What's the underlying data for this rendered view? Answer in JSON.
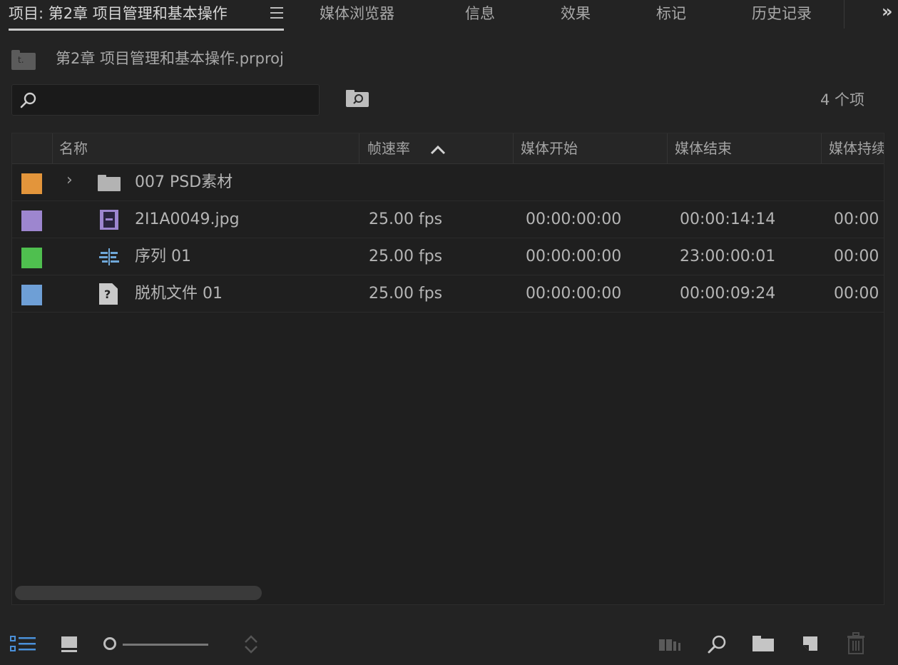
{
  "tabs": [
    {
      "label": "项目: 第2章 项目管理和基本操作",
      "active": true
    },
    {
      "label": "媒体浏览器"
    },
    {
      "label": "信息"
    },
    {
      "label": "效果"
    },
    {
      "label": "标记"
    },
    {
      "label": "历史记录"
    }
  ],
  "overflow_label": "»",
  "project": {
    "icon_glyph": "t.",
    "file_name": "第2章 项目管理和基本操作.prproj"
  },
  "search": {
    "value": "",
    "placeholder": ""
  },
  "item_count": "4 个项",
  "columns": [
    "名称",
    "帧速率",
    "媒体开始",
    "媒体结束",
    "媒体持续"
  ],
  "sort": {
    "column": "帧速率",
    "direction": "ascending"
  },
  "rows": [
    {
      "label_color": "#e3953b",
      "type": "bin",
      "expand": "›",
      "name": "007 PSD素材",
      "fps": "",
      "start": "",
      "end": "",
      "dur": ""
    },
    {
      "label_color": "#9d86cf",
      "type": "still-image",
      "name": "2I1A0049.jpg",
      "fps": "25.00 fps",
      "start": "00:00:00:00",
      "end": "00:00:14:14",
      "dur": "00:00"
    },
    {
      "label_color": "#4fbf4f",
      "type": "sequence",
      "name": "序列 01",
      "fps": "25.00 fps",
      "start": "00:00:00:00",
      "end": "23:00:00:01",
      "dur": "00:00"
    },
    {
      "label_color": "#6e9fd6",
      "type": "offline-file",
      "icon_glyph": "?",
      "name": "脱机文件 01",
      "fps": "25.00 fps",
      "start": "00:00:00:00",
      "end": "00:00:09:24",
      "dur": "00:00"
    }
  ],
  "bottom_tools": [
    "list-view-icon",
    "icon-view-icon",
    "zoom-slider",
    "sort-icons-icon",
    "automate-to-sequence-icon",
    "find-icon",
    "new-bin-icon",
    "new-item-icon",
    "trash-icon"
  ],
  "colors": {
    "background": "#232323",
    "accent": "#4a90d9"
  }
}
